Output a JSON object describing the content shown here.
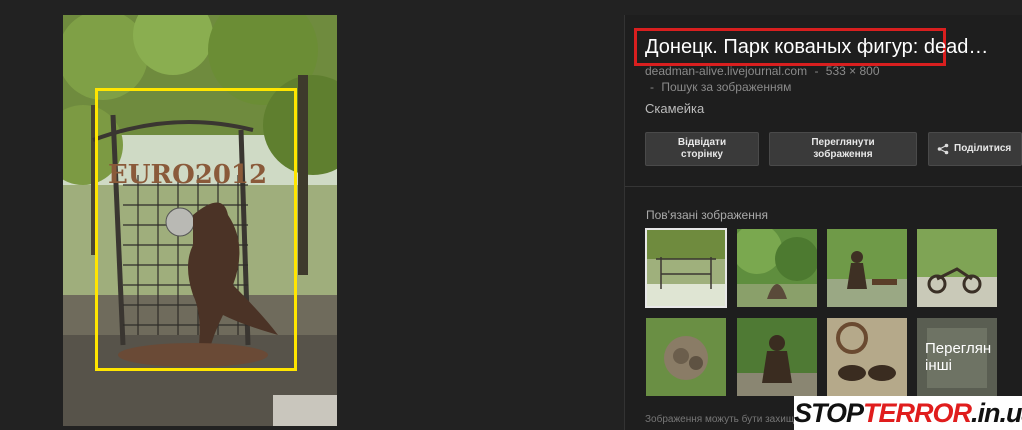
{
  "image": {
    "sign_text": "EURO2012"
  },
  "panel": {
    "title": "Донецк. Парк кованых фигур: dead…",
    "source": "deadman-alive.livejournal.com",
    "dimensions": "533 × 800",
    "search_link": "Пошук за зображенням",
    "separator": "-",
    "description": "Скамейка",
    "buttons": {
      "visit_line1": "Відвідати",
      "visit_line2": "сторінку",
      "view_line1": "Переглянути",
      "view_line2": "зображення",
      "share": "Поділитися"
    },
    "related_title": "Пов'язані зображення",
    "more_thumb": "Переглян інші",
    "footnote": "Зображення можуть бути захищ"
  },
  "watermark": {
    "part1": "STOP",
    "part2": "TERROR",
    "part3": ".in.ua"
  },
  "colors": {
    "highlight_title": "#d91f1f",
    "highlight_image": "#ffe500",
    "background": "#222222"
  }
}
